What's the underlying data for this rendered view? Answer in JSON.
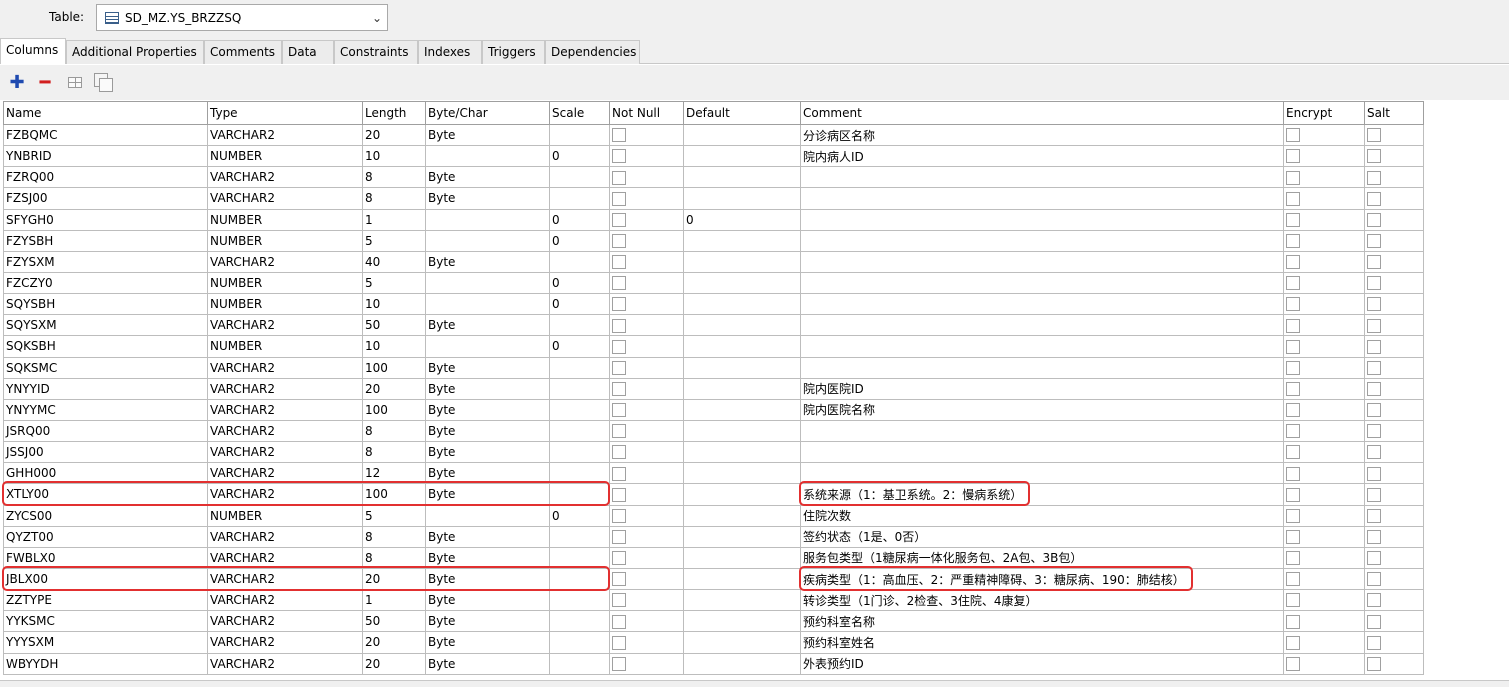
{
  "header": {
    "table_label": "Table:",
    "table_value": "SD_MZ.YS_BRZZSQ"
  },
  "tabs": [
    {
      "label": "Columns",
      "active": true
    },
    {
      "label": "Additional Properties"
    },
    {
      "label": "Comments"
    },
    {
      "label": "Data"
    },
    {
      "label": "Constraints"
    },
    {
      "label": "Indexes"
    },
    {
      "label": "Triggers"
    },
    {
      "label": "Dependencies"
    }
  ],
  "toolbar": {
    "add_icon": "plus-icon",
    "remove_icon": "minus-icon",
    "grid_icon": "grid-icon",
    "copy_icon": "copy-icon",
    "add_color": "#1f4ab0",
    "remove_color": "#d21f1f"
  },
  "grid": {
    "headers": [
      "Name",
      "Type",
      "Length",
      "Byte/Char",
      "Scale",
      "Not Null",
      "Default",
      "Comment",
      "Encrypt",
      "Salt"
    ],
    "rows": [
      {
        "name": "FZBQMC",
        "type": "VARCHAR2",
        "length": "20",
        "bytechar": "Byte",
        "scale": "",
        "default": "",
        "comment": "分诊病区名称"
      },
      {
        "name": "YNBRID",
        "type": "NUMBER",
        "length": "10",
        "bytechar": "",
        "scale": "0",
        "default": "",
        "comment": "院内病人ID"
      },
      {
        "name": "FZRQ00",
        "type": "VARCHAR2",
        "length": "8",
        "bytechar": "Byte",
        "scale": "",
        "default": "",
        "comment": ""
      },
      {
        "name": "FZSJ00",
        "type": "VARCHAR2",
        "length": "8",
        "bytechar": "Byte",
        "scale": "",
        "default": "",
        "comment": ""
      },
      {
        "name": "SFYGH0",
        "type": "NUMBER",
        "length": "1",
        "bytechar": "",
        "scale": "0",
        "default": "0",
        "comment": ""
      },
      {
        "name": "FZYSBH",
        "type": "NUMBER",
        "length": "5",
        "bytechar": "",
        "scale": "0",
        "default": "",
        "comment": ""
      },
      {
        "name": "FZYSXM",
        "type": "VARCHAR2",
        "length": "40",
        "bytechar": "Byte",
        "scale": "",
        "default": "",
        "comment": ""
      },
      {
        "name": "FZCZY0",
        "type": "NUMBER",
        "length": "5",
        "bytechar": "",
        "scale": "0",
        "default": "",
        "comment": ""
      },
      {
        "name": "SQYSBH",
        "type": "NUMBER",
        "length": "10",
        "bytechar": "",
        "scale": "0",
        "default": "",
        "comment": ""
      },
      {
        "name": "SQYSXM",
        "type": "VARCHAR2",
        "length": "50",
        "bytechar": "Byte",
        "scale": "",
        "default": "",
        "comment": ""
      },
      {
        "name": "SQKSBH",
        "type": "NUMBER",
        "length": "10",
        "bytechar": "",
        "scale": "0",
        "default": "",
        "comment": ""
      },
      {
        "name": "SQKSMC",
        "type": "VARCHAR2",
        "length": "100",
        "bytechar": "Byte",
        "scale": "",
        "default": "",
        "comment": ""
      },
      {
        "name": "YNYYID",
        "type": "VARCHAR2",
        "length": "20",
        "bytechar": "Byte",
        "scale": "",
        "default": "",
        "comment": "院内医院ID"
      },
      {
        "name": "YNYYMC",
        "type": "VARCHAR2",
        "length": "100",
        "bytechar": "Byte",
        "scale": "",
        "default": "",
        "comment": "院内医院名称"
      },
      {
        "name": "JSRQ00",
        "type": "VARCHAR2",
        "length": "8",
        "bytechar": "Byte",
        "scale": "",
        "default": "",
        "comment": ""
      },
      {
        "name": "JSSJ00",
        "type": "VARCHAR2",
        "length": "8",
        "bytechar": "Byte",
        "scale": "",
        "default": "",
        "comment": ""
      },
      {
        "name": "GHH000",
        "type": "VARCHAR2",
        "length": "12",
        "bytechar": "Byte",
        "scale": "",
        "default": "",
        "comment": ""
      },
      {
        "name": "XTLY00",
        "type": "VARCHAR2",
        "length": "100",
        "bytechar": "Byte",
        "scale": "",
        "default": "",
        "comment": "系统来源（1：基卫系统。2：慢病系统）"
      },
      {
        "name": "ZYCS00",
        "type": "NUMBER",
        "length": "5",
        "bytechar": "",
        "scale": "0",
        "default": "",
        "comment": "住院次数"
      },
      {
        "name": "QYZT00",
        "type": "VARCHAR2",
        "length": "8",
        "bytechar": "Byte",
        "scale": "",
        "default": "",
        "comment": "签约状态（1是、0否）"
      },
      {
        "name": "FWBLX0",
        "type": "VARCHAR2",
        "length": "8",
        "bytechar": "Byte",
        "scale": "",
        "default": "",
        "comment": "服务包类型（1糖尿病一体化服务包、2A包、3B包）"
      },
      {
        "name": "JBLX00",
        "type": "VARCHAR2",
        "length": "20",
        "bytechar": "Byte",
        "scale": "",
        "default": "",
        "comment": "疾病类型（1：高血压、2：严重精神障碍、3：糖尿病、190：肺结核）"
      },
      {
        "name": "ZZTYPE",
        "type": "VARCHAR2",
        "length": "1",
        "bytechar": "Byte",
        "scale": "",
        "default": "",
        "comment": "转诊类型（1门诊、2检查、3住院、4康复）"
      },
      {
        "name": "YYKSMC",
        "type": "VARCHAR2",
        "length": "50",
        "bytechar": "Byte",
        "scale": "",
        "default": "",
        "comment": "预约科室名称"
      },
      {
        "name": "YYYSXM",
        "type": "VARCHAR2",
        "length": "20",
        "bytechar": "Byte",
        "scale": "",
        "default": "",
        "comment": "预约科室姓名"
      },
      {
        "name": "WBYYDH",
        "type": "VARCHAR2",
        "length": "20",
        "bytechar": "Byte",
        "scale": "",
        "default": "",
        "comment": "外表预约ID"
      }
    ],
    "highlighted_rows": [
      "XTLY00",
      "JBLX00"
    ],
    "highlight_color": "#e23030"
  }
}
